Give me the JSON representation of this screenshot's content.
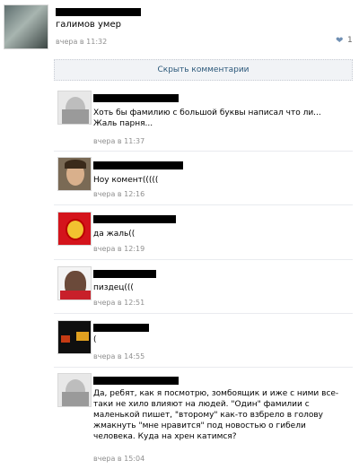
{
  "post": {
    "text": "галимов умер",
    "time": "вчера в 11:32",
    "likes": "1"
  },
  "hide_comments_label": "Скрыть комментарии",
  "comments": [
    {
      "text": "Хоть бы фамилию с большой буквы написал что ли...\nЖаль парня...",
      "time": "вчера в 11:37"
    },
    {
      "text": "Ноу комент(((((",
      "time": "вчера в 12:16"
    },
    {
      "text": "да жаль((",
      "time": "вчера в 12:19"
    },
    {
      "text": "пиздец(((",
      "time": "вчера в 12:51"
    },
    {
      "text": "(",
      "time": "вчера в 14:55"
    },
    {
      "text": "Да, ребят, как я посмотрю, зомбоящик и иже с ними все-\nтаки не хило влияют на людей. \"Один\" фамилии с\nмаленькой пишет, \"второму\" как-то взбрело в голову\nжмакнуть \"мне нравится\" под новостью о гибели\nчеловека. Куда на хрен катимся?",
      "time": "вчера в 15:04"
    }
  ]
}
